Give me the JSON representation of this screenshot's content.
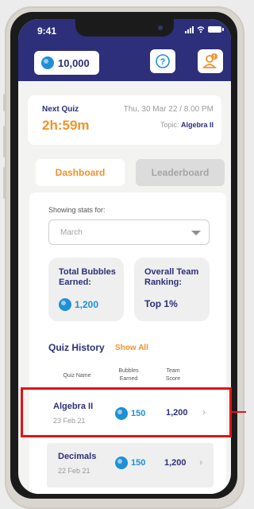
{
  "status": {
    "time": "9:41"
  },
  "header": {
    "balance": "10,000",
    "help_label": "?"
  },
  "next_quiz": {
    "label": "Next Quiz",
    "countdown": "2h:59m",
    "date_time": "Thu, 30 Mar 22 / 8.00 PM",
    "topic_prefix": "Topic:",
    "topic": "Algebra II"
  },
  "tabs": [
    {
      "label": "Dashboard",
      "active": true
    },
    {
      "label": "Leaderboard",
      "active": false
    }
  ],
  "stats": {
    "showing_label": "Showing stats for:",
    "period": "March",
    "total_title": "Total Bubbles Earned:",
    "total_value": "1,200",
    "ranking_title": "Overall Team Ranking:",
    "ranking_value": "Top 1%"
  },
  "quiz_history": {
    "title": "Quiz History",
    "show_all": "Show All",
    "columns": {
      "name": "Quiz Name",
      "bubbles": "Bubbles Earned",
      "score": "Team Score"
    },
    "rows": [
      {
        "name": "Algebra II",
        "date": "23 Feb 21",
        "bubbles": "150",
        "score": "1,200"
      },
      {
        "name": "Decimals",
        "date": "22 Feb 21",
        "bubbles": "150",
        "score": "1,200"
      }
    ]
  },
  "colors": {
    "navy": "#2d2f7a",
    "orange": "#f0932b",
    "blue": "#1f8fd6",
    "highlight": "#e0131b"
  }
}
